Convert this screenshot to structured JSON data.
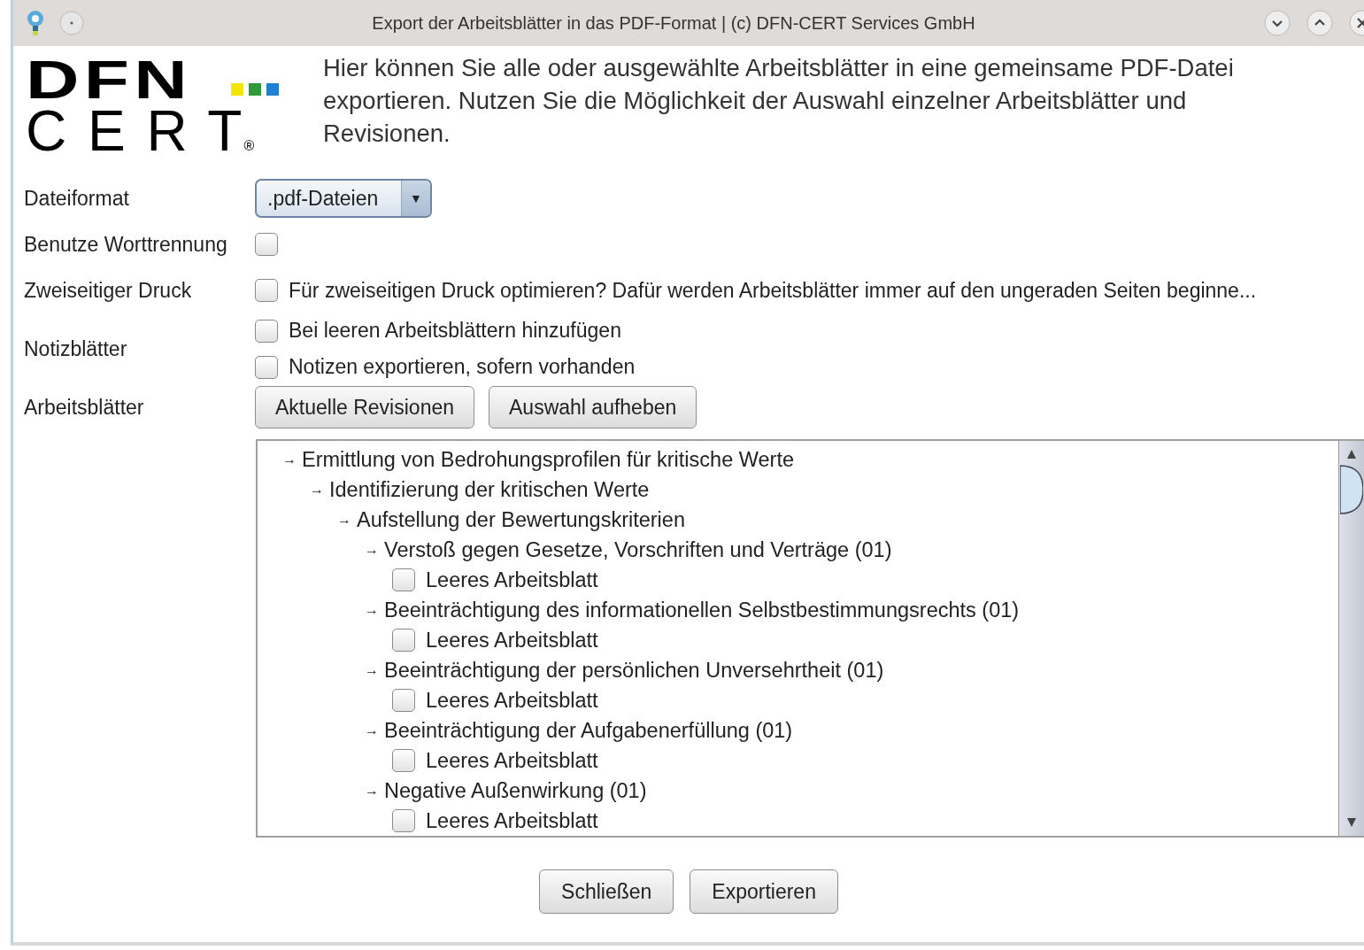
{
  "window": {
    "title": "Export der Arbeitsblätter in das PDF-Format | (c) DFN-CERT Services GmbH"
  },
  "logo": {
    "top": "DFN",
    "bottom": "C E R T",
    "mark": "®"
  },
  "description": "Hier können Sie alle oder ausgewählte Arbeitsblätter in eine gemeinsame PDF-Datei exportieren. Nutzen Sie die Möglichkeit der Auswahl einzelner Arbeitsblätter und Revisionen.",
  "form": [
    {
      "kind": "dropdown",
      "label": "Dateiformat",
      "value": ".pdf-Dateien",
      "caret": "▼"
    },
    {
      "kind": "checks",
      "label": "Benutze Worttrennung",
      "options": [
        {
          "checked": false
        }
      ]
    },
    {
      "kind": "checks",
      "label": "Zweiseitiger Druck",
      "options": [
        {
          "text": "Für zweiseitigen Druck optimieren? Dafür werden Arbeitsblätter immer auf den ungeraden Seiten beginne...",
          "checked": false
        }
      ]
    },
    {
      "kind": "checks",
      "label": "Notizblätter",
      "options": [
        {
          "text": "Bei leeren Arbeitsblättern hinzufügen",
          "checked": false
        },
        {
          "text": "Notizen exportieren, sofern vorhanden",
          "checked": false
        }
      ]
    },
    {
      "kind": "buttons",
      "label": "Arbeitsblätter",
      "buttons": [
        "Aktuelle Revisionen",
        "Auswahl aufheben"
      ]
    }
  ],
  "tree": [
    {
      "kind": "node",
      "marker": "→",
      "label": "Ermittlung von Bedrohungsprofilen für kritische Werte",
      "children": [
        {
          "kind": "node",
          "marker": "→",
          "label": "Identifizierung der kritischen Werte",
          "children": [
            {
              "kind": "node",
              "marker": "→",
              "label": "Aufstellung der Bewertungskriterien",
              "children": [
                {
                  "kind": "node",
                  "marker": "→",
                  "label": "Verstoß gegen Gesetze, Vorschriften und Verträge (01)",
                  "children": [
                    {
                      "kind": "check",
                      "label": "Leeres Arbeitsblatt",
                      "checked": false
                    }
                  ]
                },
                {
                  "kind": "node",
                  "marker": "→",
                  "label": "Beeinträchtigung des informationellen Selbstbestimmungsrechts (01)",
                  "children": [
                    {
                      "kind": "check",
                      "label": "Leeres Arbeitsblatt",
                      "checked": false
                    }
                  ]
                },
                {
                  "kind": "node",
                  "marker": "→",
                  "label": "Beeinträchtigung der persönlichen Unversehrtheit (01)",
                  "children": [
                    {
                      "kind": "check",
                      "label": "Leeres Arbeitsblatt",
                      "checked": false
                    }
                  ]
                },
                {
                  "kind": "node",
                  "marker": "→",
                  "label": "Beeinträchtigung der Aufgabenerfüllung (01)",
                  "children": [
                    {
                      "kind": "check",
                      "label": "Leeres Arbeitsblatt",
                      "checked": false
                    }
                  ]
                },
                {
                  "kind": "node",
                  "marker": "→",
                  "label": "Negative Außenwirkung (01)",
                  "children": [
                    {
                      "kind": "check",
                      "label": "Leeres Arbeitsblatt",
                      "checked": false
                    }
                  ]
                }
              ]
            }
          ]
        }
      ]
    }
  ],
  "buttons": [
    "Schließen",
    "Exportieren"
  ]
}
